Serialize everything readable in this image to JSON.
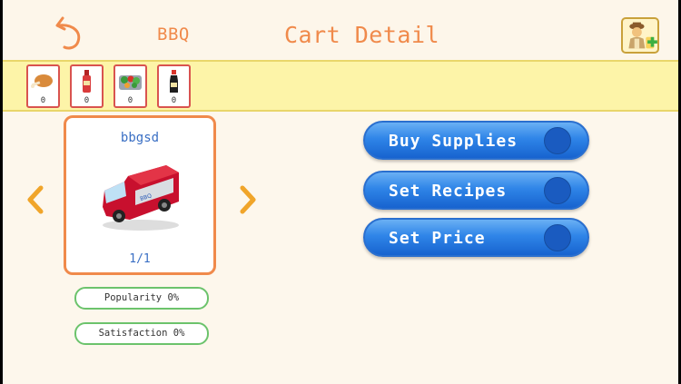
{
  "header": {
    "cart_name": "BBQ",
    "title": "Cart Detail",
    "back_icon": "undo-arrow-icon",
    "chef_icon": "chef-add-icon"
  },
  "ingredients": [
    {
      "icon": "chicken-leg-icon",
      "count": "0"
    },
    {
      "icon": "sauce-bottle-icon",
      "count": "0"
    },
    {
      "icon": "vegetable-tray-icon",
      "count": "0"
    },
    {
      "icon": "soy-sauce-bottle-icon",
      "count": "0"
    }
  ],
  "cart": {
    "label": "bbgsd",
    "page": "1/1",
    "image": "red-food-van"
  },
  "stats": {
    "popularity": "Popularity 0%",
    "satisfaction": "Satisfaction 0%"
  },
  "actions": {
    "buy_supplies": "Buy Supplies",
    "set_recipes": "Set Recipes",
    "set_price": "Set Price"
  },
  "colors": {
    "accent_orange": "#f08a4b",
    "button_blue": "#2f85e8",
    "bar_yellow": "#fdf4a8",
    "stat_green": "#6cc36c"
  }
}
